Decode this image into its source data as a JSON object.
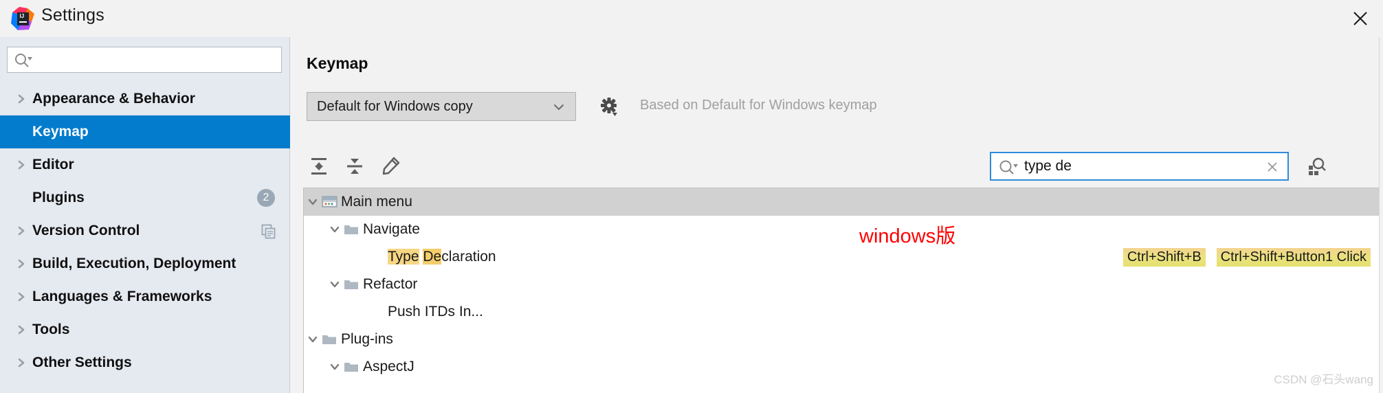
{
  "window": {
    "title": "Settings",
    "logo_icon": "intellij-idea-logo",
    "close_icon": "close-icon"
  },
  "sidebar": {
    "search": {
      "value": "",
      "placeholder": "",
      "icon": "search-dropdown-icon"
    },
    "items": [
      {
        "label": "Appearance & Behavior",
        "expandable": true,
        "selected": false,
        "badge": null,
        "icon": null
      },
      {
        "label": "Keymap",
        "expandable": false,
        "selected": true,
        "badge": null,
        "icon": null
      },
      {
        "label": "Editor",
        "expandable": true,
        "selected": false,
        "badge": null,
        "icon": null
      },
      {
        "label": "Plugins",
        "expandable": false,
        "selected": false,
        "badge": "2",
        "icon": null
      },
      {
        "label": "Version Control",
        "expandable": true,
        "selected": false,
        "badge": null,
        "icon": "copy-icon"
      },
      {
        "label": "Build, Execution, Deployment",
        "expandable": true,
        "selected": false,
        "badge": null,
        "icon": null
      },
      {
        "label": "Languages & Frameworks",
        "expandable": true,
        "selected": false,
        "badge": null,
        "icon": null
      },
      {
        "label": "Tools",
        "expandable": true,
        "selected": false,
        "badge": null,
        "icon": null
      },
      {
        "label": "Other Settings",
        "expandable": true,
        "selected": false,
        "badge": null,
        "icon": null
      }
    ]
  },
  "main": {
    "page_title": "Keymap",
    "keymap_select": {
      "value": "Default for Windows copy",
      "options": [
        "Default for Windows copy"
      ],
      "arrow_icon": "chevron-down-icon"
    },
    "gear_button_icon": "gear-dropdown-icon",
    "based_on_text": "Based on Default for Windows keymap",
    "toolbar": [
      {
        "name": "expand-all-button",
        "icon": "expand-all-icon"
      },
      {
        "name": "collapse-all-button",
        "icon": "collapse-all-icon"
      },
      {
        "name": "edit-shortcut-button",
        "icon": "pencil-icon"
      }
    ],
    "tree_search": {
      "value": "type de",
      "placeholder": "",
      "search_icon": "search-dropdown-icon",
      "clear_icon": "close-icon"
    },
    "find_by_shortcut_icon": "find-by-shortcut-icon",
    "tree": [
      {
        "label": "Main menu",
        "indent": 0,
        "chevron": "chevron-down-icon",
        "icon": "menu-bar-icon",
        "highlighted": true,
        "match_prefix": "",
        "match_mid": "",
        "rest": "Main menu",
        "shortcuts": []
      },
      {
        "label": "Navigate",
        "indent": 1,
        "chevron": "chevron-down-icon",
        "icon": "folder-icon",
        "highlighted": false,
        "match_prefix": "",
        "match_mid": "",
        "rest": "Navigate",
        "shortcuts": []
      },
      {
        "label": "Type Declaration",
        "indent": 2,
        "chevron": null,
        "icon": null,
        "highlighted": false,
        "match_prefix": "Type",
        "match_mid": "De",
        "rest": "claration",
        "shortcuts": [
          "Ctrl+Shift+B",
          "Ctrl+Shift+Button1 Click"
        ]
      },
      {
        "label": "Refactor",
        "indent": 1,
        "chevron": "chevron-down-icon",
        "icon": "folder-icon",
        "highlighted": false,
        "match_prefix": "",
        "match_mid": "",
        "rest": "Refactor",
        "shortcuts": []
      },
      {
        "label": "Push ITDs In...",
        "indent": 2,
        "chevron": null,
        "icon": null,
        "highlighted": false,
        "match_prefix": "",
        "match_mid": "",
        "rest": "Push ITDs In...",
        "shortcuts": []
      },
      {
        "label": "Plug-ins",
        "indent": 0,
        "chevron": "chevron-down-icon",
        "icon": "folder-icon",
        "highlighted": false,
        "match_prefix": "",
        "match_mid": "",
        "rest": "Plug-ins",
        "shortcuts": []
      },
      {
        "label": "AspectJ",
        "indent": 1,
        "chevron": "chevron-down-icon",
        "icon": "folder-icon",
        "highlighted": false,
        "match_prefix": "",
        "match_mid": "",
        "rest": "AspectJ",
        "shortcuts": []
      }
    ]
  },
  "annotations": {
    "red_note": "windows版",
    "watermark": "CSDN @石头wang"
  },
  "colors": {
    "selection_blue": "#037ccd",
    "focus_blue": "#2d8bdb",
    "sidebar_bg": "#e5e9f0",
    "panel_bg": "#f2f2f2",
    "match_yellow": "#f7d684",
    "shortcut_badge": "#ebe27e",
    "annotation_red": "#ff0000"
  }
}
